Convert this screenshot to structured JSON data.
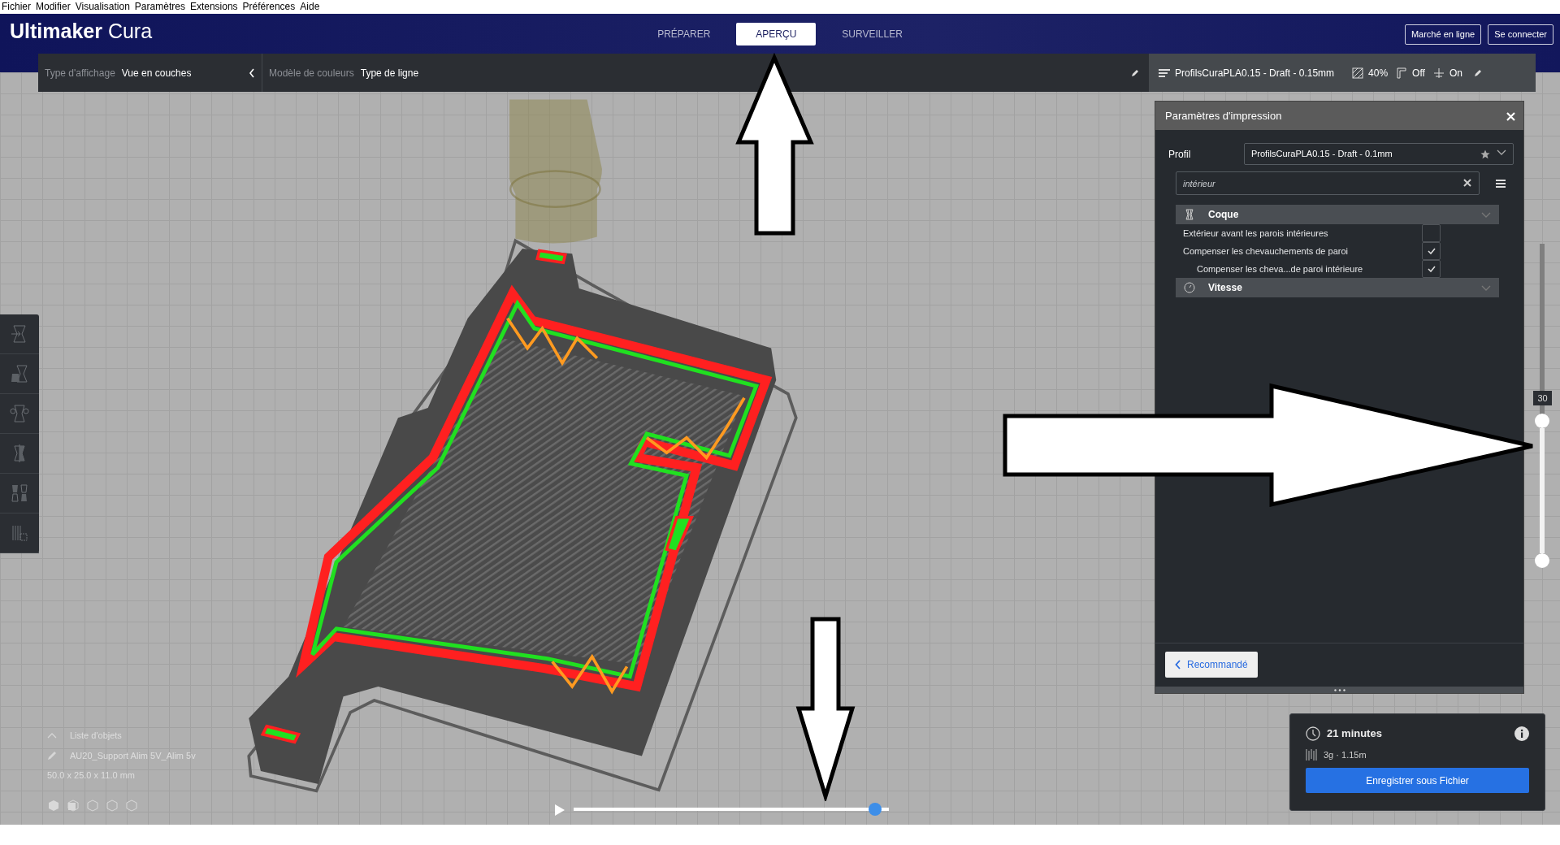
{
  "menu_bar": [
    "Fichier",
    "Modifier",
    "Visualisation",
    "Paramètres",
    "Extensions",
    "Préférences",
    "Aide"
  ],
  "header": {
    "logo": {
      "brand": "Ultimaker",
      "product": "Cura"
    },
    "tabs": [
      {
        "label": "PRÉPARER",
        "selected": false
      },
      {
        "label": "APERÇU",
        "selected": true
      },
      {
        "label": "SURVEILLER",
        "selected": false
      }
    ],
    "buttons": [
      "Marché en ligne",
      "Se connecter"
    ]
  },
  "view_bar": {
    "view_type_label": "Type d'affichage",
    "view_type_value": "Vue en couches",
    "color_scheme_label": "Modèle de couleurs",
    "color_scheme_value": "Type de ligne"
  },
  "print_summary": {
    "profile": "ProfilsCuraPLA0.15 - Draft - 0.15mm",
    "infill": "40%",
    "support": "Off",
    "adhesion": "On"
  },
  "print_settings": {
    "title": "Paramètres d'impression",
    "profile_label": "Profil",
    "profile_value": "ProfilsCuraPLA0.15 - Draft - 0.1mm",
    "search": {
      "value": "intérieur"
    },
    "categories": [
      {
        "label": "Coque",
        "settings": [
          {
            "label": "Extérieur avant les parois intérieures",
            "checked": false
          },
          {
            "label": "Compenser les chevauchements de paroi",
            "checked": true,
            "children": [
              {
                "label": "Compenser les cheva...de paroi intérieure",
                "checked": true
              }
            ]
          }
        ]
      },
      {
        "label": "Vitesse"
      }
    ],
    "recommended_button": "Recommandé"
  },
  "layer_slider": {
    "label": "30",
    "level": 0.44
  },
  "object_list": {
    "title": "Liste d'objets",
    "object_name": "AU20_Support Alim 5V_Alim 5v",
    "dimensions": "50.0 x 25.0 x 11.0 mm"
  },
  "playback": {
    "level": 0.955
  },
  "print_estimate": {
    "time": "21 minutes",
    "material": "3g · 1.15m",
    "button": "Enregistrer sous Fichier"
  }
}
